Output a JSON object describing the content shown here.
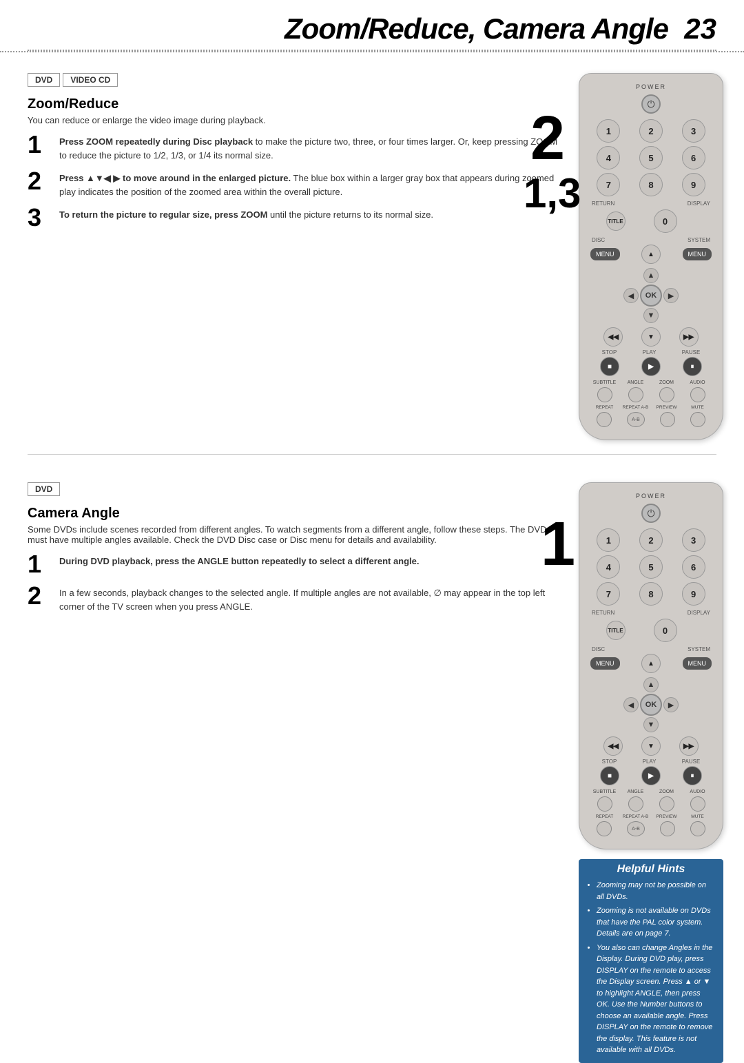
{
  "header": {
    "title": "Zoom/Reduce, Camera Angle",
    "page_number": "23"
  },
  "top_section": {
    "badges": [
      "DVD",
      "VIDEO CD"
    ],
    "zoom_reduce": {
      "title": "Zoom/Reduce",
      "description": "You can reduce or enlarge the video image during playback.",
      "steps": [
        {
          "number": "1",
          "text_bold": "Press ZOOM repeatedly during Disc playback",
          "text_rest": " to make the picture two, three, or four times larger. Or, keep pressing ZOOM to reduce the picture to 1/2, 1/3, or 1/4 its normal size."
        },
        {
          "number": "2",
          "text_bold": "Press ▲▼◀ ▶ to move around in the enlarged picture.",
          "text_rest": " The blue box within a larger gray box that appears during zoomed play indicates the position of the zoomed area within the overall picture."
        },
        {
          "number": "3",
          "text_bold": "To return the picture to regular size, press ZOOM",
          "text_rest": " until the picture returns to its normal size."
        }
      ],
      "big_numbers": [
        "2",
        "1,3"
      ]
    }
  },
  "bottom_section": {
    "badges": [
      "DVD"
    ],
    "camera_angle": {
      "title": "Camera Angle",
      "description": "Some DVDs include scenes recorded from different angles. To watch segments from a different angle, follow these steps. The DVD must have multiple angles available. Check the DVD Disc case or Disc menu for details and availability.",
      "steps": [
        {
          "number": "1",
          "text_bold": "During DVD playback, press the ANGLE button repeatedly to select a different angle."
        },
        {
          "number": "2",
          "text_rest": "In a few seconds, playback changes to the selected angle. If multiple angles are not available, ∅ may appear in the top left corner of the TV screen when you press ANGLE."
        }
      ],
      "big_number": "1"
    }
  },
  "helpful_hints": {
    "title": "Helpful Hints",
    "items": [
      "Zooming may not be possible on all DVDs.",
      "Zooming is not available on DVDs that have the PAL color system. Details are on page 7.",
      "You also can change Angles in the Display. During DVD play, press DISPLAY on the remote to access the Display screen. Press ▲ or ▼ to highlight ANGLE, then press OK. Use the Number buttons to choose an available angle. Press DISPLAY on the remote to remove the display. This feature is not available with all DVDs."
    ]
  },
  "remote": {
    "power_label": "POWER",
    "numbers": [
      "1",
      "2",
      "3",
      "4",
      "5",
      "6",
      "7",
      "8",
      "9"
    ],
    "labels_row1": [
      "RETURN",
      "",
      "DISPLAY"
    ],
    "labels_row2": [
      "TITLE",
      "0",
      ""
    ],
    "labels_row3": [
      "DISC",
      "",
      "SYSTEM"
    ],
    "menu_labels": [
      "MENU",
      "▲",
      "MENU"
    ],
    "ok_label": "OK",
    "arrows": [
      "▲",
      "▼",
      "◀",
      "▶"
    ],
    "skip_left": "◀◀",
    "skip_right": "▶▶",
    "down_arrow": "▼",
    "play_labels": [
      "STOP",
      "PLAY",
      "PAUSE"
    ],
    "bottom_labels": [
      "SUBTITLE",
      "ANGLE",
      "ZOOM",
      "AUDIO"
    ],
    "repeat_labels": [
      "REPEAT",
      "REPEAT A-B",
      "PREVIEW",
      "MUTE"
    ]
  }
}
